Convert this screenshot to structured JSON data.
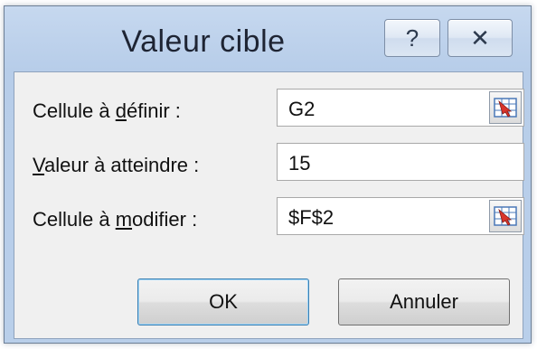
{
  "window": {
    "title": "Valeur cible",
    "help_label": "?",
    "close_label": "✕"
  },
  "fields": [
    {
      "label_pre": "Cellule à ",
      "label_u": "d",
      "label_post": "éfinir :",
      "value": "G2",
      "has_ref_button": true
    },
    {
      "label_pre": "",
      "label_u": "V",
      "label_post": "aleur à atteindre :",
      "value": "15",
      "has_ref_button": false
    },
    {
      "label_pre": "Cellule à ",
      "label_u": "m",
      "label_post": "odifier :",
      "value": "$F$2",
      "has_ref_button": true
    }
  ],
  "buttons": {
    "ok_label": "OK",
    "cancel_label": "Annuler"
  },
  "icons": {
    "ref_button_icon": "range-select-icon",
    "help_icon": "help-icon",
    "close_icon": "close-icon"
  }
}
